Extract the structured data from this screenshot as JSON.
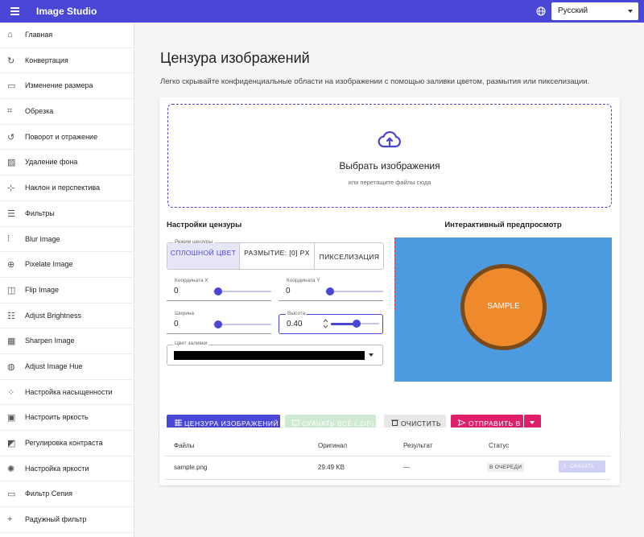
{
  "app": {
    "title": "Image Studio",
    "accent_color": "#4a46d6",
    "language": {
      "selected": "Русский"
    }
  },
  "sidebar": {
    "items": [
      {
        "label": "Главная",
        "icon": "home-icon"
      },
      {
        "label": "Конвертация",
        "icon": "convert-icon"
      },
      {
        "label": "Изменение размера",
        "icon": "resize-icon"
      },
      {
        "label": "Обрезка",
        "icon": "crop-icon"
      },
      {
        "label": "Поворот и отражение",
        "icon": "rotate-icon"
      },
      {
        "label": "Удаление фона",
        "icon": "remove-background-icon"
      },
      {
        "label": "Наклон и перспектива",
        "icon": "perspective-icon"
      },
      {
        "label": "Фильтры",
        "icon": "tune-icon"
      },
      {
        "label": "Blur Image",
        "icon": "blur-icon"
      },
      {
        "label": "Pixelate Image",
        "icon": "pixelate-icon"
      },
      {
        "label": "Flip Image",
        "icon": "flip-icon"
      },
      {
        "label": "Adjust Brightness",
        "icon": "brightness-icon"
      },
      {
        "label": "Sharpen Image",
        "icon": "sharpen-icon"
      },
      {
        "label": "Adjust Image Hue",
        "icon": "palette-icon"
      },
      {
        "label": "Настройка насыщенности",
        "icon": "saturation-icon"
      },
      {
        "label": "Настроить яркость",
        "icon": "exposure-icon"
      },
      {
        "label": "Регулировка контраста",
        "icon": "contrast-icon"
      },
      {
        "label": "Настройка яркости",
        "icon": "brightness-settings-icon"
      },
      {
        "label": "Фильтр Сепия",
        "icon": "sepia-icon"
      },
      {
        "label": "Радужный фильтр",
        "icon": "rainbow-filter-icon"
      }
    ]
  },
  "page": {
    "title": "Цензура изображений",
    "subtitle": "Легко скрывайте конфиденциальные области на изображении с помощью заливки цветом, размытия или пикселизации."
  },
  "dropzone": {
    "title": "Выбрать изображения",
    "hint": "или перетащите файлы сюда"
  },
  "settings": {
    "title": "Настройки цензуры",
    "mode": {
      "legend": "Режим цензуры",
      "options": [
        {
          "label": "СПЛОШНОЙ ЦВЕТ",
          "active": true
        },
        {
          "label": "РАЗМЫТИЕ: [0] PX",
          "active": false
        },
        {
          "label": "ПИКСЕЛИЗАЦИЯ",
          "active": false
        }
      ]
    },
    "fields": {
      "x": {
        "label": "Координата X",
        "value": "0",
        "slider": 0.0
      },
      "y": {
        "label": "Координата Y",
        "value": "0",
        "slider": 0.0
      },
      "width": {
        "label": "Ширина",
        "value": "0",
        "slider": 0.0
      },
      "height": {
        "label": "Высота",
        "value": "0.40",
        "slider": 0.4
      }
    },
    "fill_color": {
      "label": "Цвет заливки",
      "value": "#000000"
    }
  },
  "preview": {
    "title": "Интерактивный предпросмотр",
    "sample_label": "SAMPLE",
    "bg_color": "#4c9be0",
    "circle_color": "#ee8a2c",
    "circle_border_color": "#7a4a1a"
  },
  "actions": {
    "censor": "ЦЕНЗУРА ИЗОБРАЖЕНИЙ",
    "download_all": "СКАЧАТЬ ВСЁ (.ZIP)",
    "clear": "ОЧИСТИТЬ",
    "send_to": "ОТПРАВИТЬ В"
  },
  "files_table": {
    "headers": [
      "Файлы",
      "Оригинал",
      "Результат",
      "Статус"
    ],
    "rows": [
      {
        "name": "sample.png",
        "original": "29.49 KB",
        "result": "—",
        "status": "В ОЧЕРЕДИ",
        "download": "СКАЧАТЬ"
      }
    ]
  }
}
